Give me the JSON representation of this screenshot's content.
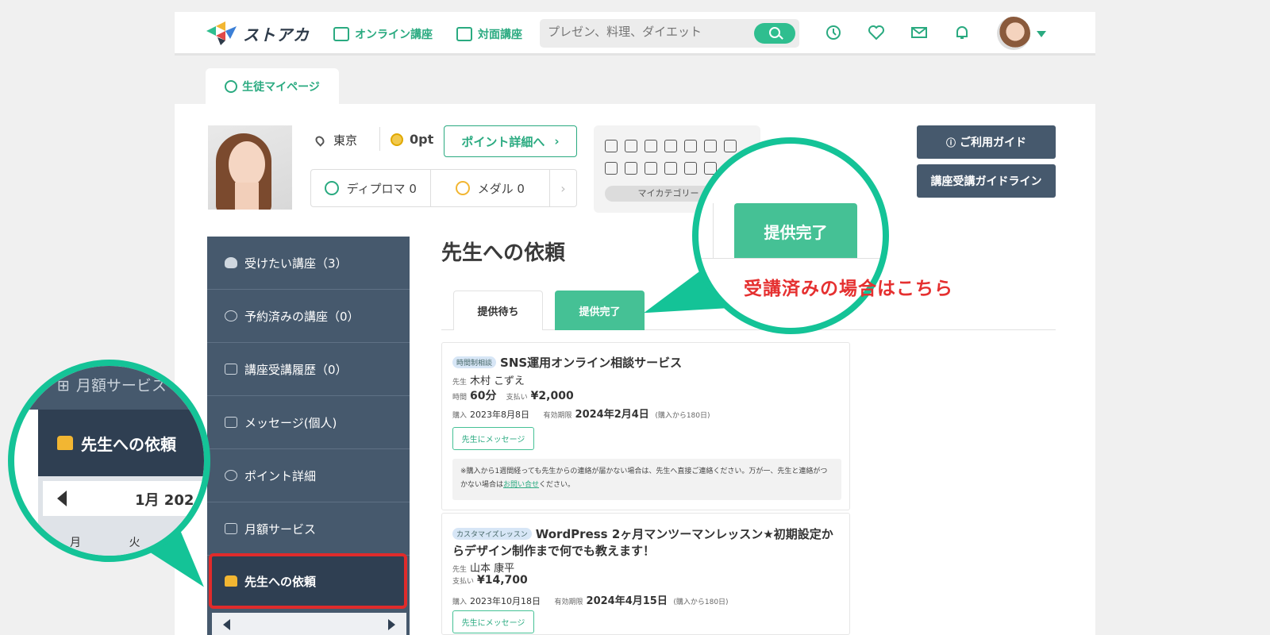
{
  "header": {
    "logo_text": "ストアカ",
    "nav": [
      {
        "label": "オンライン講座"
      },
      {
        "label": "対面講座"
      }
    ],
    "search": {
      "placeholder": "プレゼン、料理、ダイエット"
    },
    "icons": [
      "history-icon",
      "heart-icon",
      "mail-icon",
      "bell-icon"
    ]
  },
  "mypage_tab": {
    "label": "生徒マイページ"
  },
  "profile": {
    "location": "東京",
    "points": "0pt",
    "points_button": "ポイント詳細へ",
    "diploma": "ディプロマ 0",
    "medal": "メダル 0",
    "category_label": "マイカテゴリー"
  },
  "guides": {
    "usage": "ご利用ガイド",
    "course": "講座受講ガイドライン"
  },
  "sidebar": {
    "items": [
      {
        "label": "受けたい講座（3）"
      },
      {
        "label": "予約済みの講座（0）"
      },
      {
        "label": "講座受講履歴（0）"
      },
      {
        "label": "メッセージ(個人)"
      },
      {
        "label": "ポイント詳細"
      },
      {
        "label": "月額サービス"
      }
    ],
    "active": {
      "label": "先生への依頼"
    }
  },
  "main": {
    "title": "先生への依頼",
    "tabs": [
      {
        "label": "提供待ち"
      },
      {
        "label": "提供完了"
      }
    ],
    "cards": [
      {
        "badge": "時間制相談",
        "title": "SNS運用オンライン相談サービス",
        "teacher_label": "先生",
        "teacher": "木村 こずえ",
        "time_label": "時間",
        "time": "60分",
        "pay_label": "支払い",
        "pay": "¥2,000",
        "purchase_label": "購入",
        "purchase": "2023年8月8日",
        "expiry_label": "有効期限",
        "expiry": "2024年2月4日",
        "expiry_note": "(購入から180日)",
        "message_button": "先生にメッセージ",
        "note_text": "※購入から1週間経っても先生からの連絡が届かない場合は、先生へ直接ご連絡ください。万が一、先生と連絡がつかない場合は",
        "note_link": "お問い合せ",
        "note_tail": "ください。"
      },
      {
        "badge": "カスタマイズレッスン",
        "title_line1": "WordPress 2ヶ月マンツーマンレッスン★初期設定か",
        "title_line2": "らデザイン制作まで何でも教えます！",
        "teacher_label": "先生",
        "teacher": "山本 康平",
        "pay_label": "支払い",
        "pay": "¥14,700",
        "purchase_label": "購入",
        "purchase": "2023年10月18日",
        "expiry_label": "有効期限",
        "expiry": "2024年4月15日",
        "expiry_note": "(購入から180日)",
        "message_button": "先生にメッセージ"
      }
    ]
  },
  "callout": {
    "zoom_tab": "提供完了",
    "text": "受講済みの場合はこちら",
    "zoom_left_top": "月額サービス",
    "zoom_left_active": "先生への依頼",
    "zoom_left_month": "1月 202",
    "zoom_left_days": "月 火"
  },
  "colors": {
    "accent": "#2aaa80",
    "sidebar": "#46596d",
    "callout": "#14c397",
    "highlight_border": "#e02b2b",
    "callout_text": "#e53030"
  }
}
